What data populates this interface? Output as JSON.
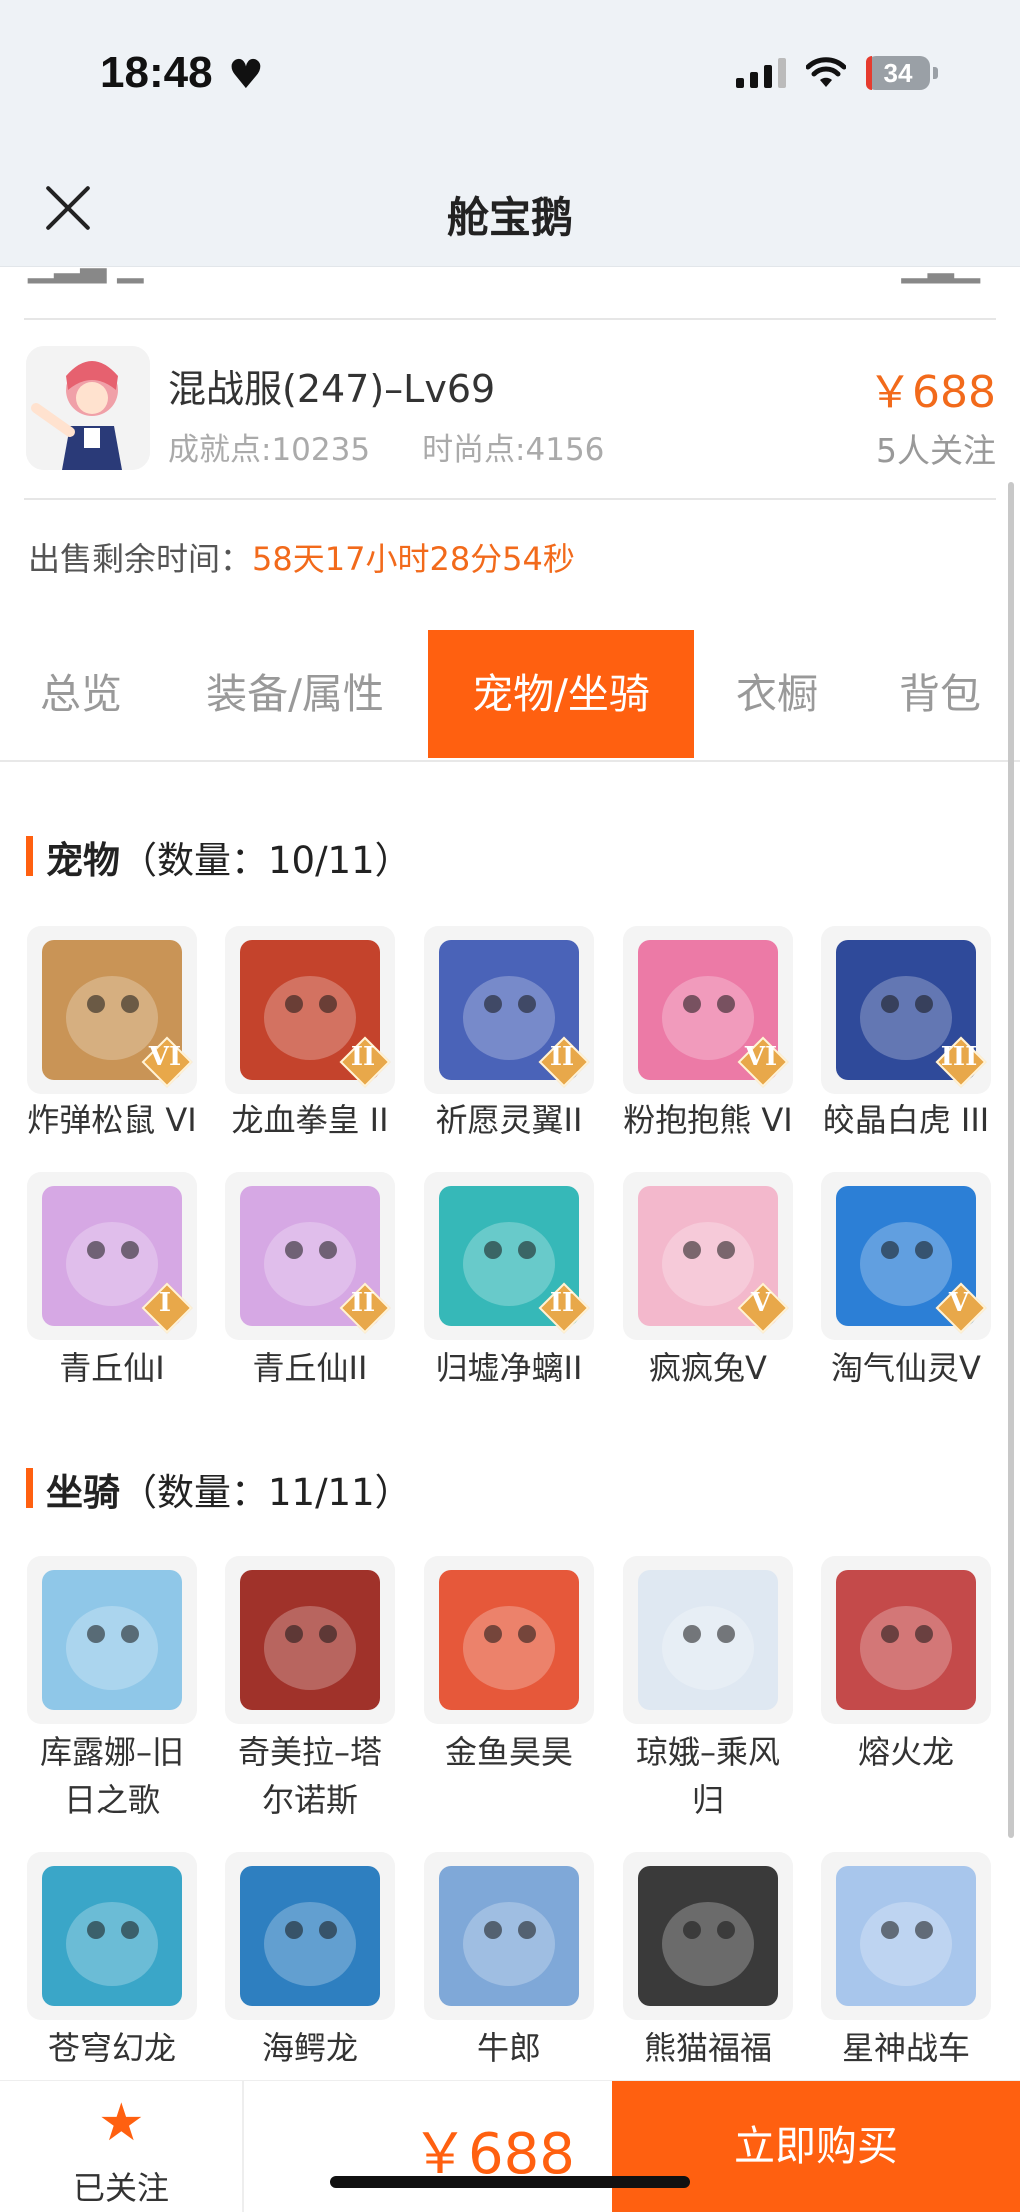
{
  "status_bar": {
    "time": "18:48",
    "battery": "34"
  },
  "nav": {
    "title": "舱宝鹅"
  },
  "product": {
    "name": "混战服(247)–Lv69",
    "achievement": "成就点:10235",
    "fashion": "时尚点:4156",
    "price": "￥688",
    "followers": "5人关注"
  },
  "sale": {
    "label": "出售剩余时间：",
    "value": "58天17小时28分54秒"
  },
  "tabs": [
    {
      "label": "总览"
    },
    {
      "label": "装备/属性"
    },
    {
      "label": "宠物/坐骑",
      "active": true
    },
    {
      "label": "衣橱"
    },
    {
      "label": "背包"
    }
  ],
  "pets": {
    "title": "宠物",
    "count": "（数量：10/11）",
    "items": [
      {
        "name": "炸弹松鼠 VI",
        "rank": "VI",
        "color": "#c99456"
      },
      {
        "name": "龙血拳皇 II",
        "rank": "II",
        "color": "#c4432c"
      },
      {
        "name": "祈愿灵翼II",
        "rank": "II",
        "color": "#4a63b8"
      },
      {
        "name": "粉抱抱熊 VI",
        "rank": "VI",
        "color": "#ec7aa6"
      },
      {
        "name": "皎晶白虎 III",
        "rank": "III",
        "color": "#2f4a9a"
      },
      {
        "name": "青丘仙I",
        "rank": "I",
        "color": "#d6a8e4"
      },
      {
        "name": "青丘仙II",
        "rank": "II",
        "color": "#d6a8e4"
      },
      {
        "name": "归墟净螭II",
        "rank": "II",
        "color": "#36b8b8"
      },
      {
        "name": "疯疯兔V",
        "rank": "V",
        "color": "#f3b8cc"
      },
      {
        "name": "淘气仙灵V",
        "rank": "V",
        "color": "#2c7fd6"
      }
    ]
  },
  "mounts": {
    "title": "坐骑",
    "count": "（数量：11/11）",
    "items": [
      {
        "name": "库露娜–旧日之歌",
        "color": "#8fc7e8"
      },
      {
        "name": "奇美拉–塔尔诺斯",
        "color": "#a0322a"
      },
      {
        "name": "金鱼昊昊",
        "color": "#e6583a"
      },
      {
        "name": "琼娥–乘风归",
        "color": "#dfe8f2"
      },
      {
        "name": "熔火龙",
        "color": "#c44a4a"
      },
      {
        "name": "苍穹幻龙",
        "color": "#3aa6c8"
      },
      {
        "name": "海鳄龙",
        "color": "#2e7fc0"
      },
      {
        "name": "牛郎",
        "color": "#7fa8d8"
      },
      {
        "name": "熊猫福福",
        "color": "#3a3a3a"
      },
      {
        "name": "星神战车",
        "color": "#a8c6ec"
      }
    ]
  },
  "bottom": {
    "follow_label": "已关注",
    "price": "￥688",
    "buy_label": "立即购买"
  }
}
